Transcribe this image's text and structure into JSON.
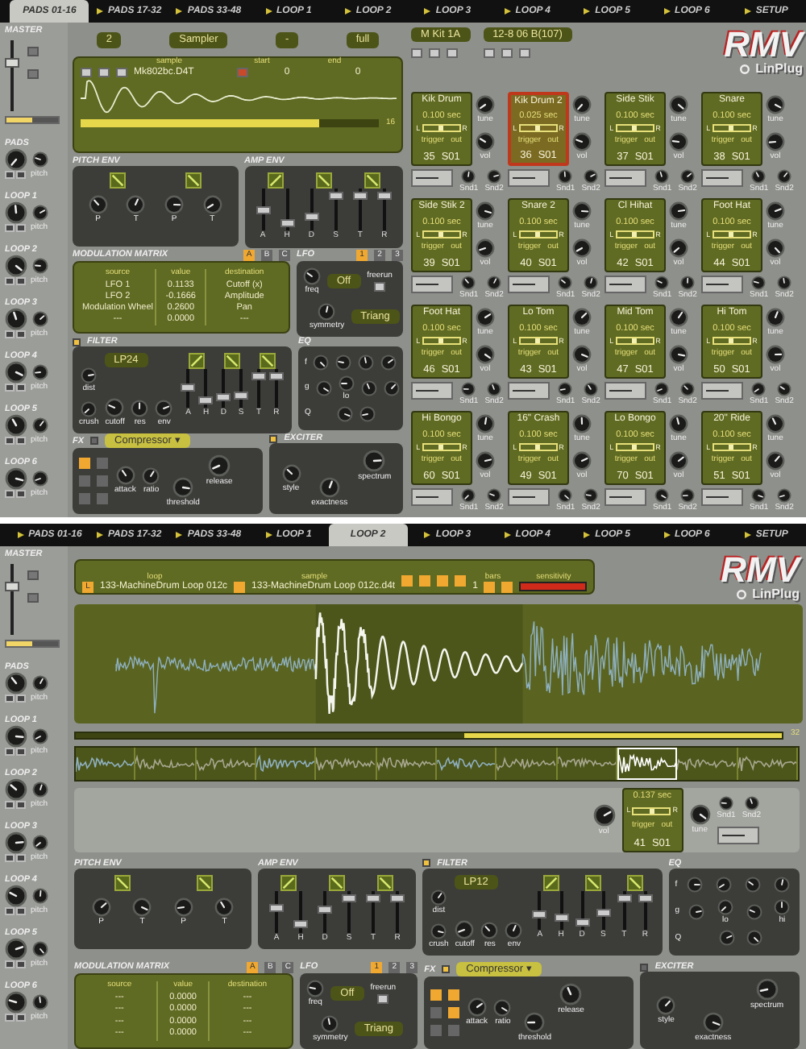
{
  "panels": [
    {
      "kind": "pads",
      "tabs": [
        {
          "label": "PADS 01-16",
          "selected": true
        },
        {
          "label": "PADS 17-32",
          "selected": false
        },
        {
          "label": "PADS 33-48",
          "selected": false
        },
        {
          "label": "LOOP 1",
          "selected": false
        },
        {
          "label": "LOOP 2",
          "selected": false
        },
        {
          "label": "LOOP 3",
          "selected": false
        },
        {
          "label": "LOOP 4",
          "selected": false
        },
        {
          "label": "LOOP 5",
          "selected": false
        },
        {
          "label": "LOOP 6",
          "selected": false
        },
        {
          "label": "SETUP",
          "selected": false
        }
      ],
      "sidebar": {
        "title": "MASTER",
        "volume": {
          "level": 0.72
        },
        "sections": [
          {
            "label": "PADS",
            "knob": "pitch"
          },
          {
            "label": "LOOP 1",
            "knob": "pitch"
          },
          {
            "label": "LOOP 2",
            "knob": "pitch"
          },
          {
            "label": "LOOP 3",
            "knob": "pitch"
          },
          {
            "label": "LOOP 4",
            "knob": "pitch"
          },
          {
            "label": "LOOP 5",
            "knob": "pitch"
          },
          {
            "label": "LOOP 6",
            "knob": "pitch"
          }
        ]
      },
      "fields": [
        "2",
        "Sampler",
        "-",
        "full"
      ],
      "sample": {
        "columns": [
          "sample",
          "start",
          "end"
        ],
        "file": "Mk802bc.D4T",
        "start": "0",
        "end": "0",
        "zoom": "16"
      },
      "kit": "M Kit 1A",
      "pattern": "12-8 06 B(107)",
      "logo": "RMV",
      "brand": "LinPlug",
      "pads": [
        {
          "name": "Kik Drum",
          "length": "0.100 sec",
          "pan": {
            "labels": [
              "L",
              "R"
            ],
            "level": 0.5
          },
          "trigger": "trigger",
          "out": "out",
          "note": "35",
          "output": "S01",
          "tune": "tune",
          "vol": "vol",
          "snd1": "Snd1",
          "snd2": "Snd2",
          "selected": false
        },
        {
          "name": "Kik Drum 2",
          "length": "0.025 sec",
          "pan": {
            "labels": [
              "L",
              "R"
            ],
            "level": 0.5
          },
          "trigger": "trigger",
          "out": "out",
          "note": "36",
          "output": "S01",
          "tune": "tune",
          "vol": "vol",
          "snd1": "Snd1",
          "snd2": "Snd2",
          "selected": true
        },
        {
          "name": "Side Stik",
          "length": "0.100 sec",
          "pan": {
            "labels": [
              "L",
              "R"
            ],
            "level": 0.5
          },
          "trigger": "trigger",
          "out": "out",
          "note": "37",
          "output": "S01",
          "tune": "tune",
          "vol": "vol",
          "snd1": "Snd1",
          "snd2": "Snd2",
          "selected": false
        },
        {
          "name": "Snare",
          "length": "0.100 sec",
          "pan": {
            "labels": [
              "L",
              "R"
            ],
            "level": 0.5
          },
          "trigger": "trigger",
          "out": "out",
          "note": "38",
          "output": "S01",
          "tune": "tune",
          "vol": "vol",
          "snd1": "Snd1",
          "snd2": "Snd2",
          "selected": false
        },
        {
          "name": "Side Stik 2",
          "length": "0.100 sec",
          "pan": {
            "labels": [
              "L",
              "R"
            ],
            "level": 0.5
          },
          "trigger": "trigger",
          "out": "out",
          "note": "39",
          "output": "S01",
          "tune": "tune",
          "vol": "vol",
          "snd1": "Snd1",
          "snd2": "Snd2",
          "selected": false
        },
        {
          "name": "Snare 2",
          "length": "0.100 sec",
          "pan": {
            "labels": [
              "L",
              "R"
            ],
            "level": 0.5
          },
          "trigger": "trigger",
          "out": "out",
          "note": "40",
          "output": "S01",
          "tune": "tune",
          "vol": "vol",
          "snd1": "Snd1",
          "snd2": "Snd2",
          "selected": false
        },
        {
          "name": "Cl Hihat",
          "length": "0.100 sec",
          "pan": {
            "labels": [
              "L",
              "R"
            ],
            "level": 0.5
          },
          "trigger": "trigger",
          "out": "out",
          "note": "42",
          "output": "S01",
          "tune": "tune",
          "vol": "vol",
          "snd1": "Snd1",
          "snd2": "Snd2",
          "selected": false
        },
        {
          "name": "Foot Hat",
          "length": "0.100 sec",
          "pan": {
            "labels": [
              "L",
              "R"
            ],
            "level": 0.5
          },
          "trigger": "trigger",
          "out": "out",
          "note": "44",
          "output": "S01",
          "tune": "tune",
          "vol": "vol",
          "snd1": "Snd1",
          "snd2": "Snd2",
          "selected": false
        },
        {
          "name": "Foot Hat",
          "length": "0.100 sec",
          "pan": {
            "labels": [
              "L",
              "R"
            ],
            "level": 0.5
          },
          "trigger": "trigger",
          "out": "out",
          "note": "46",
          "output": "S01",
          "tune": "tune",
          "vol": "vol",
          "snd1": "Snd1",
          "snd2": "Snd2",
          "selected": false
        },
        {
          "name": "Lo Tom",
          "length": "0.100 sec",
          "pan": {
            "labels": [
              "L",
              "R"
            ],
            "level": 0.5
          },
          "trigger": "trigger",
          "out": "out",
          "note": "43",
          "output": "S01",
          "tune": "tune",
          "vol": "vol",
          "snd1": "Snd1",
          "snd2": "Snd2",
          "selected": false
        },
        {
          "name": "Mid Tom",
          "length": "0.100 sec",
          "pan": {
            "labels": [
              "L",
              "R"
            ],
            "level": 0.5
          },
          "trigger": "trigger",
          "out": "out",
          "note": "47",
          "output": "S01",
          "tune": "tune",
          "vol": "vol",
          "snd1": "Snd1",
          "snd2": "Snd2",
          "selected": false
        },
        {
          "name": "Hi Tom",
          "length": "0.100 sec",
          "pan": {
            "labels": [
              "L",
              "R"
            ],
            "level": 0.5
          },
          "trigger": "trigger",
          "out": "out",
          "note": "50",
          "output": "S01",
          "tune": "tune",
          "vol": "vol",
          "snd1": "Snd1",
          "snd2": "Snd2",
          "selected": false
        },
        {
          "name": "Hi Bongo",
          "length": "0.100 sec",
          "pan": {
            "labels": [
              "L",
              "R"
            ],
            "level": 0.5
          },
          "trigger": "trigger",
          "out": "out",
          "note": "60",
          "output": "S01",
          "tune": "tune",
          "vol": "vol",
          "snd1": "Snd1",
          "snd2": "Snd2",
          "selected": false
        },
        {
          "name": "16\" Crash",
          "length": "0.100 sec",
          "pan": {
            "labels": [
              "L",
              "R"
            ],
            "level": 0.5
          },
          "trigger": "trigger",
          "out": "out",
          "note": "49",
          "output": "S01",
          "tune": "tune",
          "vol": "vol",
          "snd1": "Snd1",
          "snd2": "Snd2",
          "selected": false
        },
        {
          "name": "Lo Bongo",
          "length": "0.100 sec",
          "pan": {
            "labels": [
              "L",
              "R"
            ],
            "level": 0.5
          },
          "trigger": "trigger",
          "out": "out",
          "note": "70",
          "output": "S01",
          "tune": "tune",
          "vol": "vol",
          "snd1": "Snd1",
          "snd2": "Snd2",
          "selected": false
        },
        {
          "name": "20\" Ride",
          "length": "0.100 sec",
          "pan": {
            "labels": [
              "L",
              "R"
            ],
            "level": 0.5
          },
          "trigger": "trigger",
          "out": "out",
          "note": "51",
          "output": "S01",
          "tune": "tune",
          "vol": "vol",
          "snd1": "Snd1",
          "snd2": "Snd2",
          "selected": false
        }
      ],
      "pitch_env": {
        "title": "PITCH ENV",
        "knobs": [
          "P",
          "T",
          "P",
          "T"
        ]
      },
      "amp_env": {
        "title": "AMP ENV",
        "faders": [
          {
            "label": "A",
            "level": 0.5
          },
          {
            "label": "H",
            "level": 0.08
          },
          {
            "label": "D",
            "level": 0.3
          },
          {
            "label": "S",
            "level": 0.95
          },
          {
            "label": "T",
            "level": 0.95
          },
          {
            "label": "R",
            "level": 0.95
          }
        ]
      },
      "mod_matrix": {
        "title": "MODULATION MATRIX",
        "pages": [
          {
            "label": "A",
            "selected": true
          },
          {
            "label": "B",
            "selected": false
          },
          {
            "label": "C",
            "selected": false
          }
        ],
        "columns": [
          "source",
          "value",
          "destination"
        ],
        "rows": [
          [
            "LFO 1",
            "0.1133",
            "Cutoff (x)"
          ],
          [
            "LFO 2",
            "-0.1666",
            "Amplitude"
          ],
          [
            "Modulation Wheel",
            "0.2600",
            "Pan"
          ],
          [
            "---",
            "0.0000",
            "---"
          ]
        ]
      },
      "lfo": {
        "title": "LFO",
        "pages": [
          {
            "label": "1",
            "selected": true
          },
          {
            "label": "2",
            "selected": false
          },
          {
            "label": "3",
            "selected": false
          }
        ],
        "freq": "freq",
        "sync": "Off",
        "freerun": "freerun",
        "symmetry": "symmetry",
        "wave": "Triang"
      },
      "filter": {
        "title": "FILTER",
        "on": true,
        "type": "LP24",
        "knobs": [
          "dist",
          "crush",
          "cutoff",
          "res",
          "env"
        ],
        "faders": [
          {
            "label": "A",
            "level": 0.55
          },
          {
            "label": "H",
            "level": 0.1
          },
          {
            "label": "D",
            "level": 0.2
          },
          {
            "label": "S",
            "level": 0.3
          },
          {
            "label": "T",
            "level": 0.95
          },
          {
            "label": "R",
            "level": 0.95
          }
        ]
      },
      "eq": {
        "title": "EQ",
        "rows": [
          "f",
          "g",
          "Q"
        ],
        "bands": [
          "lo"
        ]
      },
      "fx": {
        "title": "FX",
        "on": false,
        "effect": "Compressor",
        "caret": "▾",
        "slots": [
          {
            "selected": true
          },
          {
            "selected": false
          },
          {
            "selected": false
          },
          {
            "selected": false
          },
          {
            "selected": false
          },
          {
            "selected": false
          }
        ],
        "knobs": [
          "attack",
          "ratio",
          "threshold",
          "release"
        ]
      },
      "exciter": {
        "title": "EXCITER",
        "on": true,
        "knobs": [
          "style",
          "exactness",
          "spectrum"
        ]
      }
    },
    {
      "kind": "loop",
      "tabs": [
        {
          "label": "PADS 01-16",
          "selected": false
        },
        {
          "label": "PADS 17-32",
          "selected": false
        },
        {
          "label": "PADS 33-48",
          "selected": false
        },
        {
          "label": "LOOP 1",
          "selected": false
        },
        {
          "label": "LOOP 2",
          "selected": true
        },
        {
          "label": "LOOP 3",
          "selected": false
        },
        {
          "label": "LOOP 4",
          "selected": false
        },
        {
          "label": "LOOP 5",
          "selected": false
        },
        {
          "label": "LOOP 6",
          "selected": false
        },
        {
          "label": "SETUP",
          "selected": false
        }
      ],
      "sidebar": {
        "title": "MASTER",
        "volume": {
          "level": 0.72
        },
        "sections": [
          {
            "label": "PADS",
            "knob": "pitch"
          },
          {
            "label": "LOOP 1",
            "knob": "pitch"
          },
          {
            "label": "LOOP 2",
            "knob": "pitch"
          },
          {
            "label": "LOOP 3",
            "knob": "pitch"
          },
          {
            "label": "LOOP 4",
            "knob": "pitch"
          },
          {
            "label": "LOOP 5",
            "knob": "pitch"
          },
          {
            "label": "LOOP 6",
            "knob": "pitch"
          }
        ]
      },
      "loop": {
        "loop_label": "loop",
        "loop_badge": "L",
        "loop_name": "133-MachineDrum Loop 012c",
        "sample_label": "sample",
        "sample_name": "133-MachineDrum Loop 012c.d4t",
        "bars_label": "bars",
        "bars": "1",
        "sensitivity_label": "sensitivity",
        "sensitivity": {
          "level": 1
        },
        "zoom": "32"
      },
      "logo": "RMV",
      "brand": "LinPlug",
      "slices": [
        {
          "selected": false
        },
        {
          "selected": false
        },
        {
          "selected": false
        },
        {
          "selected": false
        },
        {
          "selected": false
        },
        {
          "selected": false
        },
        {
          "selected": false
        },
        {
          "selected": false
        },
        {
          "selected": false
        },
        {
          "selected": true
        },
        {
          "selected": false
        },
        {
          "selected": false
        }
      ],
      "slice_pad": {
        "length": "0.137 sec",
        "pan": {
          "labels": [
            "L",
            "R"
          ],
          "level": 0.5
        },
        "trigger": "trigger",
        "out": "out",
        "note": "41",
        "output": "S01",
        "vol": "vol",
        "tune": "tune",
        "snd1": "Snd1",
        "snd2": "Snd2"
      },
      "pitch_env": {
        "title": "PITCH ENV",
        "knobs": [
          "P",
          "T",
          "P",
          "T"
        ]
      },
      "amp_env": {
        "title": "AMP ENV",
        "faders": [
          {
            "label": "A",
            "level": 0.65
          },
          {
            "label": "H",
            "level": 0.12
          },
          {
            "label": "D",
            "level": 0.6
          },
          {
            "label": "S",
            "level": 0.95
          },
          {
            "label": "T",
            "level": 0.95
          },
          {
            "label": "R",
            "level": 0.95
          }
        ]
      },
      "filter": {
        "title": "FILTER",
        "on": true,
        "type": "LP12",
        "knobs": [
          "dist",
          "crush",
          "cutoff",
          "res",
          "env"
        ],
        "faders": [
          {
            "label": "A",
            "level": 0.4
          },
          {
            "label": "H",
            "level": 0.28
          },
          {
            "label": "D",
            "level": 0.12
          },
          {
            "label": "S",
            "level": 0.45
          },
          {
            "label": "T",
            "level": 0.95
          },
          {
            "label": "R",
            "level": 0.95
          }
        ]
      },
      "eq": {
        "title": "EQ",
        "rows": [
          "f",
          "g",
          "Q"
        ],
        "bands": [
          "lo",
          "hi"
        ]
      },
      "mod_matrix": {
        "title": "MODULATION MATRIX",
        "pages": [
          {
            "label": "A",
            "selected": true
          },
          {
            "label": "B",
            "selected": false
          },
          {
            "label": "C",
            "selected": false
          }
        ],
        "columns": [
          "source",
          "value",
          "destination"
        ],
        "rows": [
          [
            "---",
            "0.0000",
            "---"
          ],
          [
            "---",
            "0.0000",
            "---"
          ],
          [
            "---",
            "0.0000",
            "---"
          ],
          [
            "---",
            "0.0000",
            "---"
          ]
        ]
      },
      "lfo": {
        "title": "LFO",
        "pages": [
          {
            "label": "1",
            "selected": true
          },
          {
            "label": "2",
            "selected": false
          },
          {
            "label": "3",
            "selected": false
          }
        ],
        "freq": "freq",
        "sync": "Off",
        "freerun": "freerun",
        "symmetry": "symmetry",
        "wave": "Triang"
      },
      "fx": {
        "title": "FX",
        "on": true,
        "effect": "Compressor",
        "caret": "▾",
        "slots": [
          {
            "selected": true
          },
          {
            "selected": true
          },
          {
            "selected": false
          },
          {
            "selected": true
          },
          {
            "selected": false
          },
          {
            "selected": false
          }
        ],
        "knobs": [
          "attack",
          "ratio",
          "threshold",
          "release"
        ]
      },
      "exciter": {
        "title": "EXCITER",
        "on": false,
        "knobs": [
          "style",
          "exactness",
          "spectrum"
        ]
      }
    }
  ]
}
